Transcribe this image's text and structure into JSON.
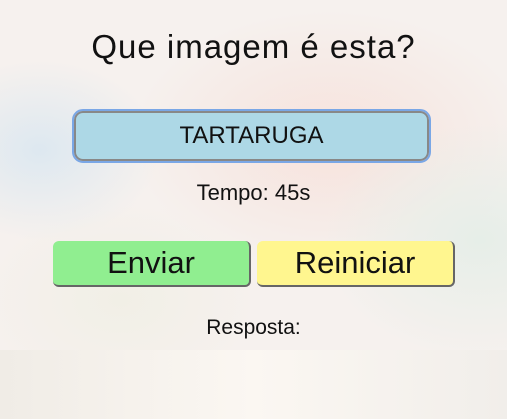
{
  "title": "Que imagem é esta?",
  "answer_value": "TARTARUGA",
  "timer_text": "Tempo: 45s",
  "buttons": {
    "send": "Enviar",
    "reset": "Reiniciar"
  },
  "response_label": "Resposta:",
  "colors": {
    "answer_bg": "#add8e6",
    "send_bg": "#90ee90",
    "reset_bg": "#fff68f"
  }
}
